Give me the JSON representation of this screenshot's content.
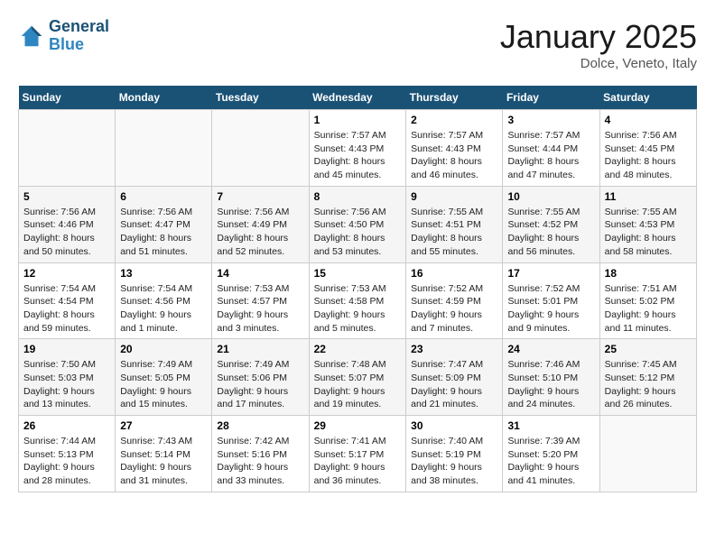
{
  "header": {
    "logo_line1": "General",
    "logo_line2": "Blue",
    "month": "January 2025",
    "location": "Dolce, Veneto, Italy"
  },
  "weekdays": [
    "Sunday",
    "Monday",
    "Tuesday",
    "Wednesday",
    "Thursday",
    "Friday",
    "Saturday"
  ],
  "weeks": [
    [
      {
        "day": "",
        "detail": ""
      },
      {
        "day": "",
        "detail": ""
      },
      {
        "day": "",
        "detail": ""
      },
      {
        "day": "1",
        "detail": "Sunrise: 7:57 AM\nSunset: 4:43 PM\nDaylight: 8 hours\nand 45 minutes."
      },
      {
        "day": "2",
        "detail": "Sunrise: 7:57 AM\nSunset: 4:43 PM\nDaylight: 8 hours\nand 46 minutes."
      },
      {
        "day": "3",
        "detail": "Sunrise: 7:57 AM\nSunset: 4:44 PM\nDaylight: 8 hours\nand 47 minutes."
      },
      {
        "day": "4",
        "detail": "Sunrise: 7:56 AM\nSunset: 4:45 PM\nDaylight: 8 hours\nand 48 minutes."
      }
    ],
    [
      {
        "day": "5",
        "detail": "Sunrise: 7:56 AM\nSunset: 4:46 PM\nDaylight: 8 hours\nand 50 minutes."
      },
      {
        "day": "6",
        "detail": "Sunrise: 7:56 AM\nSunset: 4:47 PM\nDaylight: 8 hours\nand 51 minutes."
      },
      {
        "day": "7",
        "detail": "Sunrise: 7:56 AM\nSunset: 4:49 PM\nDaylight: 8 hours\nand 52 minutes."
      },
      {
        "day": "8",
        "detail": "Sunrise: 7:56 AM\nSunset: 4:50 PM\nDaylight: 8 hours\nand 53 minutes."
      },
      {
        "day": "9",
        "detail": "Sunrise: 7:55 AM\nSunset: 4:51 PM\nDaylight: 8 hours\nand 55 minutes."
      },
      {
        "day": "10",
        "detail": "Sunrise: 7:55 AM\nSunset: 4:52 PM\nDaylight: 8 hours\nand 56 minutes."
      },
      {
        "day": "11",
        "detail": "Sunrise: 7:55 AM\nSunset: 4:53 PM\nDaylight: 8 hours\nand 58 minutes."
      }
    ],
    [
      {
        "day": "12",
        "detail": "Sunrise: 7:54 AM\nSunset: 4:54 PM\nDaylight: 8 hours\nand 59 minutes."
      },
      {
        "day": "13",
        "detail": "Sunrise: 7:54 AM\nSunset: 4:56 PM\nDaylight: 9 hours\nand 1 minute."
      },
      {
        "day": "14",
        "detail": "Sunrise: 7:53 AM\nSunset: 4:57 PM\nDaylight: 9 hours\nand 3 minutes."
      },
      {
        "day": "15",
        "detail": "Sunrise: 7:53 AM\nSunset: 4:58 PM\nDaylight: 9 hours\nand 5 minutes."
      },
      {
        "day": "16",
        "detail": "Sunrise: 7:52 AM\nSunset: 4:59 PM\nDaylight: 9 hours\nand 7 minutes."
      },
      {
        "day": "17",
        "detail": "Sunrise: 7:52 AM\nSunset: 5:01 PM\nDaylight: 9 hours\nand 9 minutes."
      },
      {
        "day": "18",
        "detail": "Sunrise: 7:51 AM\nSunset: 5:02 PM\nDaylight: 9 hours\nand 11 minutes."
      }
    ],
    [
      {
        "day": "19",
        "detail": "Sunrise: 7:50 AM\nSunset: 5:03 PM\nDaylight: 9 hours\nand 13 minutes."
      },
      {
        "day": "20",
        "detail": "Sunrise: 7:49 AM\nSunset: 5:05 PM\nDaylight: 9 hours\nand 15 minutes."
      },
      {
        "day": "21",
        "detail": "Sunrise: 7:49 AM\nSunset: 5:06 PM\nDaylight: 9 hours\nand 17 minutes."
      },
      {
        "day": "22",
        "detail": "Sunrise: 7:48 AM\nSunset: 5:07 PM\nDaylight: 9 hours\nand 19 minutes."
      },
      {
        "day": "23",
        "detail": "Sunrise: 7:47 AM\nSunset: 5:09 PM\nDaylight: 9 hours\nand 21 minutes."
      },
      {
        "day": "24",
        "detail": "Sunrise: 7:46 AM\nSunset: 5:10 PM\nDaylight: 9 hours\nand 24 minutes."
      },
      {
        "day": "25",
        "detail": "Sunrise: 7:45 AM\nSunset: 5:12 PM\nDaylight: 9 hours\nand 26 minutes."
      }
    ],
    [
      {
        "day": "26",
        "detail": "Sunrise: 7:44 AM\nSunset: 5:13 PM\nDaylight: 9 hours\nand 28 minutes."
      },
      {
        "day": "27",
        "detail": "Sunrise: 7:43 AM\nSunset: 5:14 PM\nDaylight: 9 hours\nand 31 minutes."
      },
      {
        "day": "28",
        "detail": "Sunrise: 7:42 AM\nSunset: 5:16 PM\nDaylight: 9 hours\nand 33 minutes."
      },
      {
        "day": "29",
        "detail": "Sunrise: 7:41 AM\nSunset: 5:17 PM\nDaylight: 9 hours\nand 36 minutes."
      },
      {
        "day": "30",
        "detail": "Sunrise: 7:40 AM\nSunset: 5:19 PM\nDaylight: 9 hours\nand 38 minutes."
      },
      {
        "day": "31",
        "detail": "Sunrise: 7:39 AM\nSunset: 5:20 PM\nDaylight: 9 hours\nand 41 minutes."
      },
      {
        "day": "",
        "detail": ""
      }
    ]
  ]
}
